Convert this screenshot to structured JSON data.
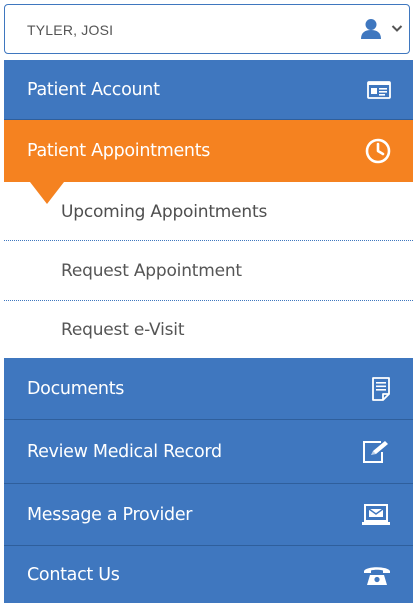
{
  "account": {
    "name": "TYLER, JOSI",
    "user_icon": "user-icon",
    "chevron_icon": "chevron-down-icon"
  },
  "colors": {
    "primary": "#3f77bf",
    "active": "#f58220",
    "submenu_text": "#555555"
  },
  "menu": {
    "patient_account": {
      "label": "Patient Account",
      "icon": "id-card-icon"
    },
    "patient_appointments": {
      "label": "Patient Appointments",
      "icon": "clock-icon"
    },
    "documents": {
      "label": "Documents",
      "icon": "document-icon"
    },
    "review_medical_record": {
      "label": "Review Medical Record",
      "icon": "edit-record-icon"
    },
    "message_provider": {
      "label": "Message a Provider",
      "icon": "laptop-mail-icon"
    },
    "contact_us": {
      "label": "Contact Us",
      "icon": "phone-icon"
    }
  },
  "submenu": {
    "upcoming": {
      "label": "Upcoming Appointments"
    },
    "request": {
      "label": "Request Appointment"
    },
    "evisit": {
      "label": "Request e-Visit"
    }
  }
}
